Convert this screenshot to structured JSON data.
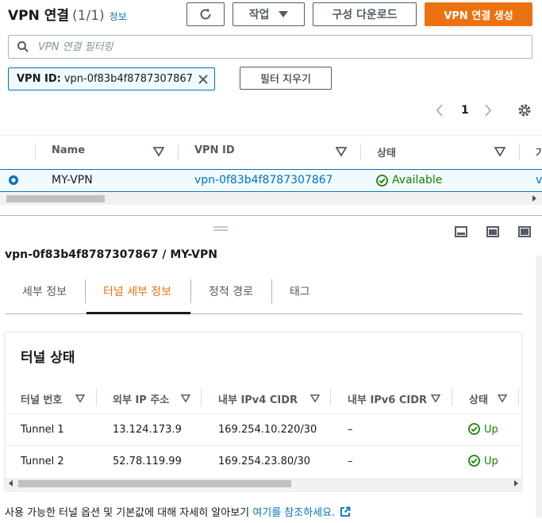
{
  "header": {
    "title": "VPN 연결",
    "count": "(1/1)",
    "info_link": "정보",
    "actions_label": "작업",
    "download_label": "구성 다운로드",
    "create_label": "VPN 연결 생성"
  },
  "search": {
    "placeholder": "VPN 연결 필터링",
    "value": ""
  },
  "filter": {
    "key": "VPN ID:",
    "value": "vpn-0f83b4f8787307867",
    "clear_label": "필터 지우기"
  },
  "pagination": {
    "page": "1"
  },
  "table": {
    "columns": [
      "Name",
      "VPN ID",
      "상태",
      "가"
    ],
    "rows": [
      {
        "name": "MY-VPN",
        "vpn_id": "vpn-0f83b4f8787307867",
        "status": "Available",
        "next": "vp"
      }
    ]
  },
  "detail": {
    "title": "vpn-0f83b4f8787307867 / MY-VPN",
    "tabs": [
      "세부 정보",
      "터널 세부 정보",
      "정적 경로",
      "태그"
    ],
    "active_tab": "터널 세부 정보",
    "section_title": "터널 상태",
    "columns": [
      "터널 번호",
      "외부 IP 주소",
      "내부 IPv4 CIDR",
      "내부 IPv6 CIDR",
      "상태"
    ],
    "rows": [
      {
        "tunnel": "Tunnel 1",
        "outside_ip": "13.124.173.9",
        "ipv4": "169.254.10.220/30",
        "ipv6": "–",
        "status": "Up"
      },
      {
        "tunnel": "Tunnel 2",
        "outside_ip": "52.78.119.99",
        "ipv4": "169.254.23.80/30",
        "ipv6": "–",
        "status": "Up"
      }
    ]
  },
  "footer": {
    "text": "사용 가능한 터널 옵션 및 기본값에 대해 자세히 알아보기",
    "link": "여기를 참조하세요."
  },
  "colors": {
    "accent": "#ec7211",
    "link": "#0073bb",
    "success": "#1d8102"
  },
  "icons": [
    "refresh-icon",
    "caret-down-icon",
    "search-icon",
    "close-icon",
    "chevron-left-icon",
    "chevron-right-icon",
    "gear-icon",
    "sort-icon",
    "radio-selected-icon",
    "status-check-icon",
    "drag-handle-icon",
    "split-view-icon",
    "external-link-icon"
  ]
}
